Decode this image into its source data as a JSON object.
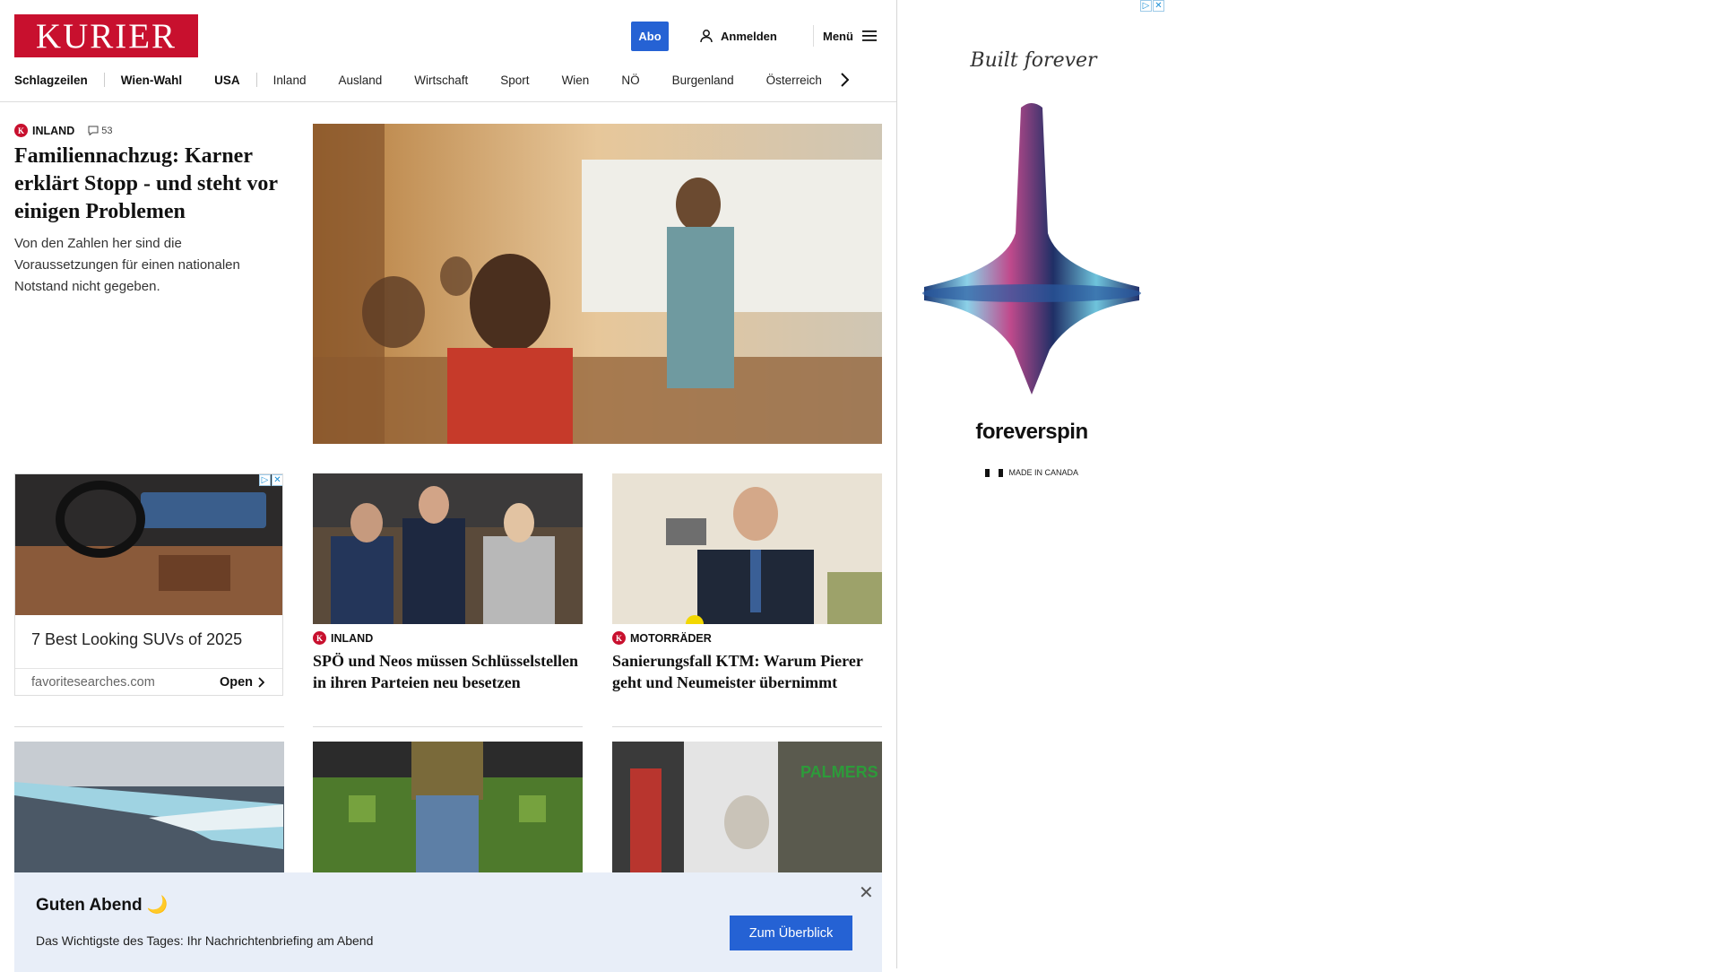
{
  "header": {
    "logo": "KURIER",
    "abo_label": "Abo",
    "login_label": "Anmelden",
    "menu_label": "Menü"
  },
  "nav": [
    "Schlagzeilen",
    "Wien-Wahl",
    "USA",
    "Inland",
    "Ausland",
    "Wirtschaft",
    "Sport",
    "Wien",
    "NÖ",
    "Burgenland",
    "Österreich"
  ],
  "lead": {
    "category": "INLAND",
    "comments": "53",
    "title": "Familiennachzug: Karner erklärt Stopp - und steht vor einigen Problemen",
    "subtitle": "Von den Zahlen her sind die Voraussetzungen für einen nationalen Notstand nicht gegeben."
  },
  "ad_card": {
    "title": "7 Best Looking SUVs of 2025",
    "source": "favoritesearches.com",
    "cta": "Open"
  },
  "cards": [
    {
      "category": "INLAND",
      "title": "SPÖ und Neos müssen Schlüsselstellen in ihren Parteien neu besetzen"
    },
    {
      "category": "MOTORRÄDER",
      "title": "Sanierungsfall KTM: Warum Pierer geht und Neumeister übernimmt"
    }
  ],
  "briefing": {
    "title": "Guten Abend 🌙",
    "text": "Das Wichtigste des Tages: Ihr Nachrichtenbriefing am Abend",
    "button": "Zum Überblick"
  },
  "side_ad": {
    "script": "Built forever",
    "brand": "foreverspin",
    "tagline": "MADE IN CANADA"
  },
  "colors": {
    "brand_red": "#c8102e",
    "accent_blue": "#2562d4",
    "briefing_bg": "#e8eef8"
  }
}
